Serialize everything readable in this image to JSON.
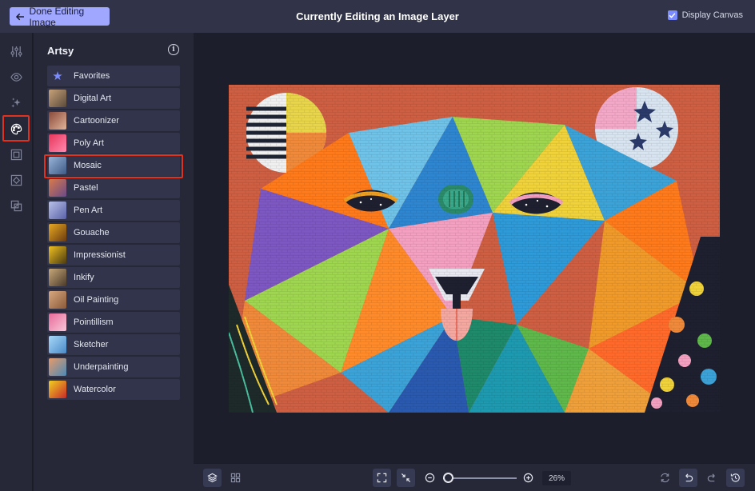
{
  "topbar": {
    "done_label": "Done Editing Image",
    "title": "Currently Editing an Image Layer",
    "display_canvas_label": "Display Canvas",
    "display_canvas_checked": true
  },
  "rail": {
    "icons": [
      "sliders-icon",
      "eye-icon",
      "sparkle-icon",
      "palette-icon",
      "frame-icon",
      "texture-icon",
      "overlay-icon"
    ],
    "active": "palette-icon"
  },
  "panel": {
    "title": "Artsy",
    "filters": [
      {
        "label": "Favorites",
        "thumb": "star",
        "colors": [
          "#7c8cff",
          "#7c8cff"
        ]
      },
      {
        "label": "Digital Art",
        "thumb": "image",
        "colors": [
          "#c8a27a",
          "#5a4a3a"
        ]
      },
      {
        "label": "Cartoonizer",
        "thumb": "image",
        "colors": [
          "#8a4a3a",
          "#e2b49a"
        ]
      },
      {
        "label": "Poly Art",
        "thumb": "image",
        "colors": [
          "#e8365a",
          "#ff8ab0"
        ]
      },
      {
        "label": "Mosaic",
        "thumb": "image",
        "colors": [
          "#9ab4d8",
          "#3e5a86"
        ]
      },
      {
        "label": "Pastel",
        "thumb": "image",
        "colors": [
          "#d87a4a",
          "#6a4a8a"
        ]
      },
      {
        "label": "Pen Art",
        "thumb": "image",
        "colors": [
          "#b8c0e8",
          "#5a62a8"
        ]
      },
      {
        "label": "Gouache",
        "thumb": "image",
        "colors": [
          "#e8a820",
          "#6a3a10"
        ]
      },
      {
        "label": "Impressionist",
        "thumb": "image",
        "colors": [
          "#f0c020",
          "#4a3a10"
        ]
      },
      {
        "label": "Inkify",
        "thumb": "image",
        "colors": [
          "#c8a87a",
          "#4a3a2a"
        ]
      },
      {
        "label": "Oil Painting",
        "thumb": "image",
        "colors": [
          "#d8a880",
          "#8a5a3a"
        ]
      },
      {
        "label": "Pointillism",
        "thumb": "image",
        "colors": [
          "#e86a9a",
          "#f8c8d8"
        ]
      },
      {
        "label": "Sketcher",
        "thumb": "image",
        "colors": [
          "#a8d8f8",
          "#4a8ac8"
        ]
      },
      {
        "label": "Underpainting",
        "thumb": "image",
        "colors": [
          "#e89a6a",
          "#4a8ab8"
        ]
      },
      {
        "label": "Watercolor",
        "thumb": "image",
        "colors": [
          "#f0d020",
          "#c82a2a"
        ]
      }
    ],
    "selected": "Mosaic"
  },
  "zoom": {
    "value_label": "26%",
    "level": 0.26
  },
  "colors": {
    "accent": "#7c8cff",
    "highlight": "#e0321f"
  }
}
